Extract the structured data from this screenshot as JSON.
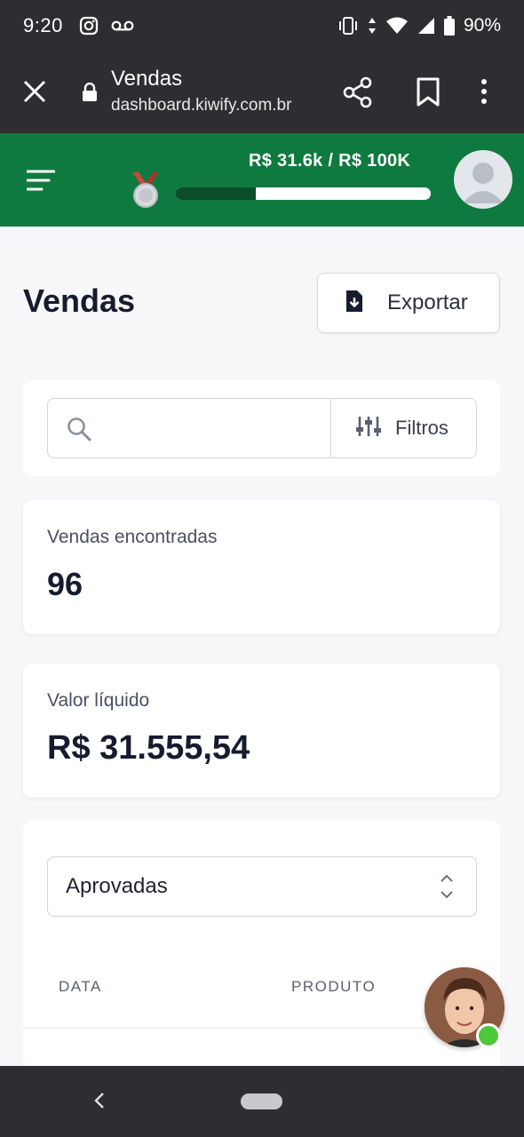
{
  "status_bar": {
    "time": "9:20",
    "battery": "90%",
    "icons": [
      "instagram-icon",
      "voicemail-icon",
      "vibrate-icon",
      "wifi-icon",
      "signal-icon",
      "battery-icon"
    ]
  },
  "browser": {
    "title": "Vendas",
    "url": "dashboard.kiwify.com.br",
    "icons": [
      "close-icon",
      "lock-icon",
      "share-icon",
      "bookmark-icon",
      "more-vert-icon"
    ]
  },
  "header": {
    "goal_text": "R$ 31.6k / R$ 100K",
    "progress_fraction": 0.316,
    "colors": {
      "header_bg": "#0e7a3f",
      "progress_fill": "#0b4f2a"
    },
    "icons": [
      "menu-icon",
      "medal-icon",
      "avatar-icon"
    ]
  },
  "page": {
    "title": "Vendas",
    "export_label": "Exportar"
  },
  "search": {
    "placeholder": "",
    "filter_label": "Filtros"
  },
  "stats": {
    "sales_found_label": "Vendas encontradas",
    "sales_found_value": "96",
    "net_value_label": "Valor líquido",
    "net_value_value": "R$ 31.555,54"
  },
  "table": {
    "status_filter": "Aprovadas",
    "columns": [
      "DATA",
      "PRODUTO"
    ]
  },
  "support": {
    "online_color": "#4cc93a"
  }
}
